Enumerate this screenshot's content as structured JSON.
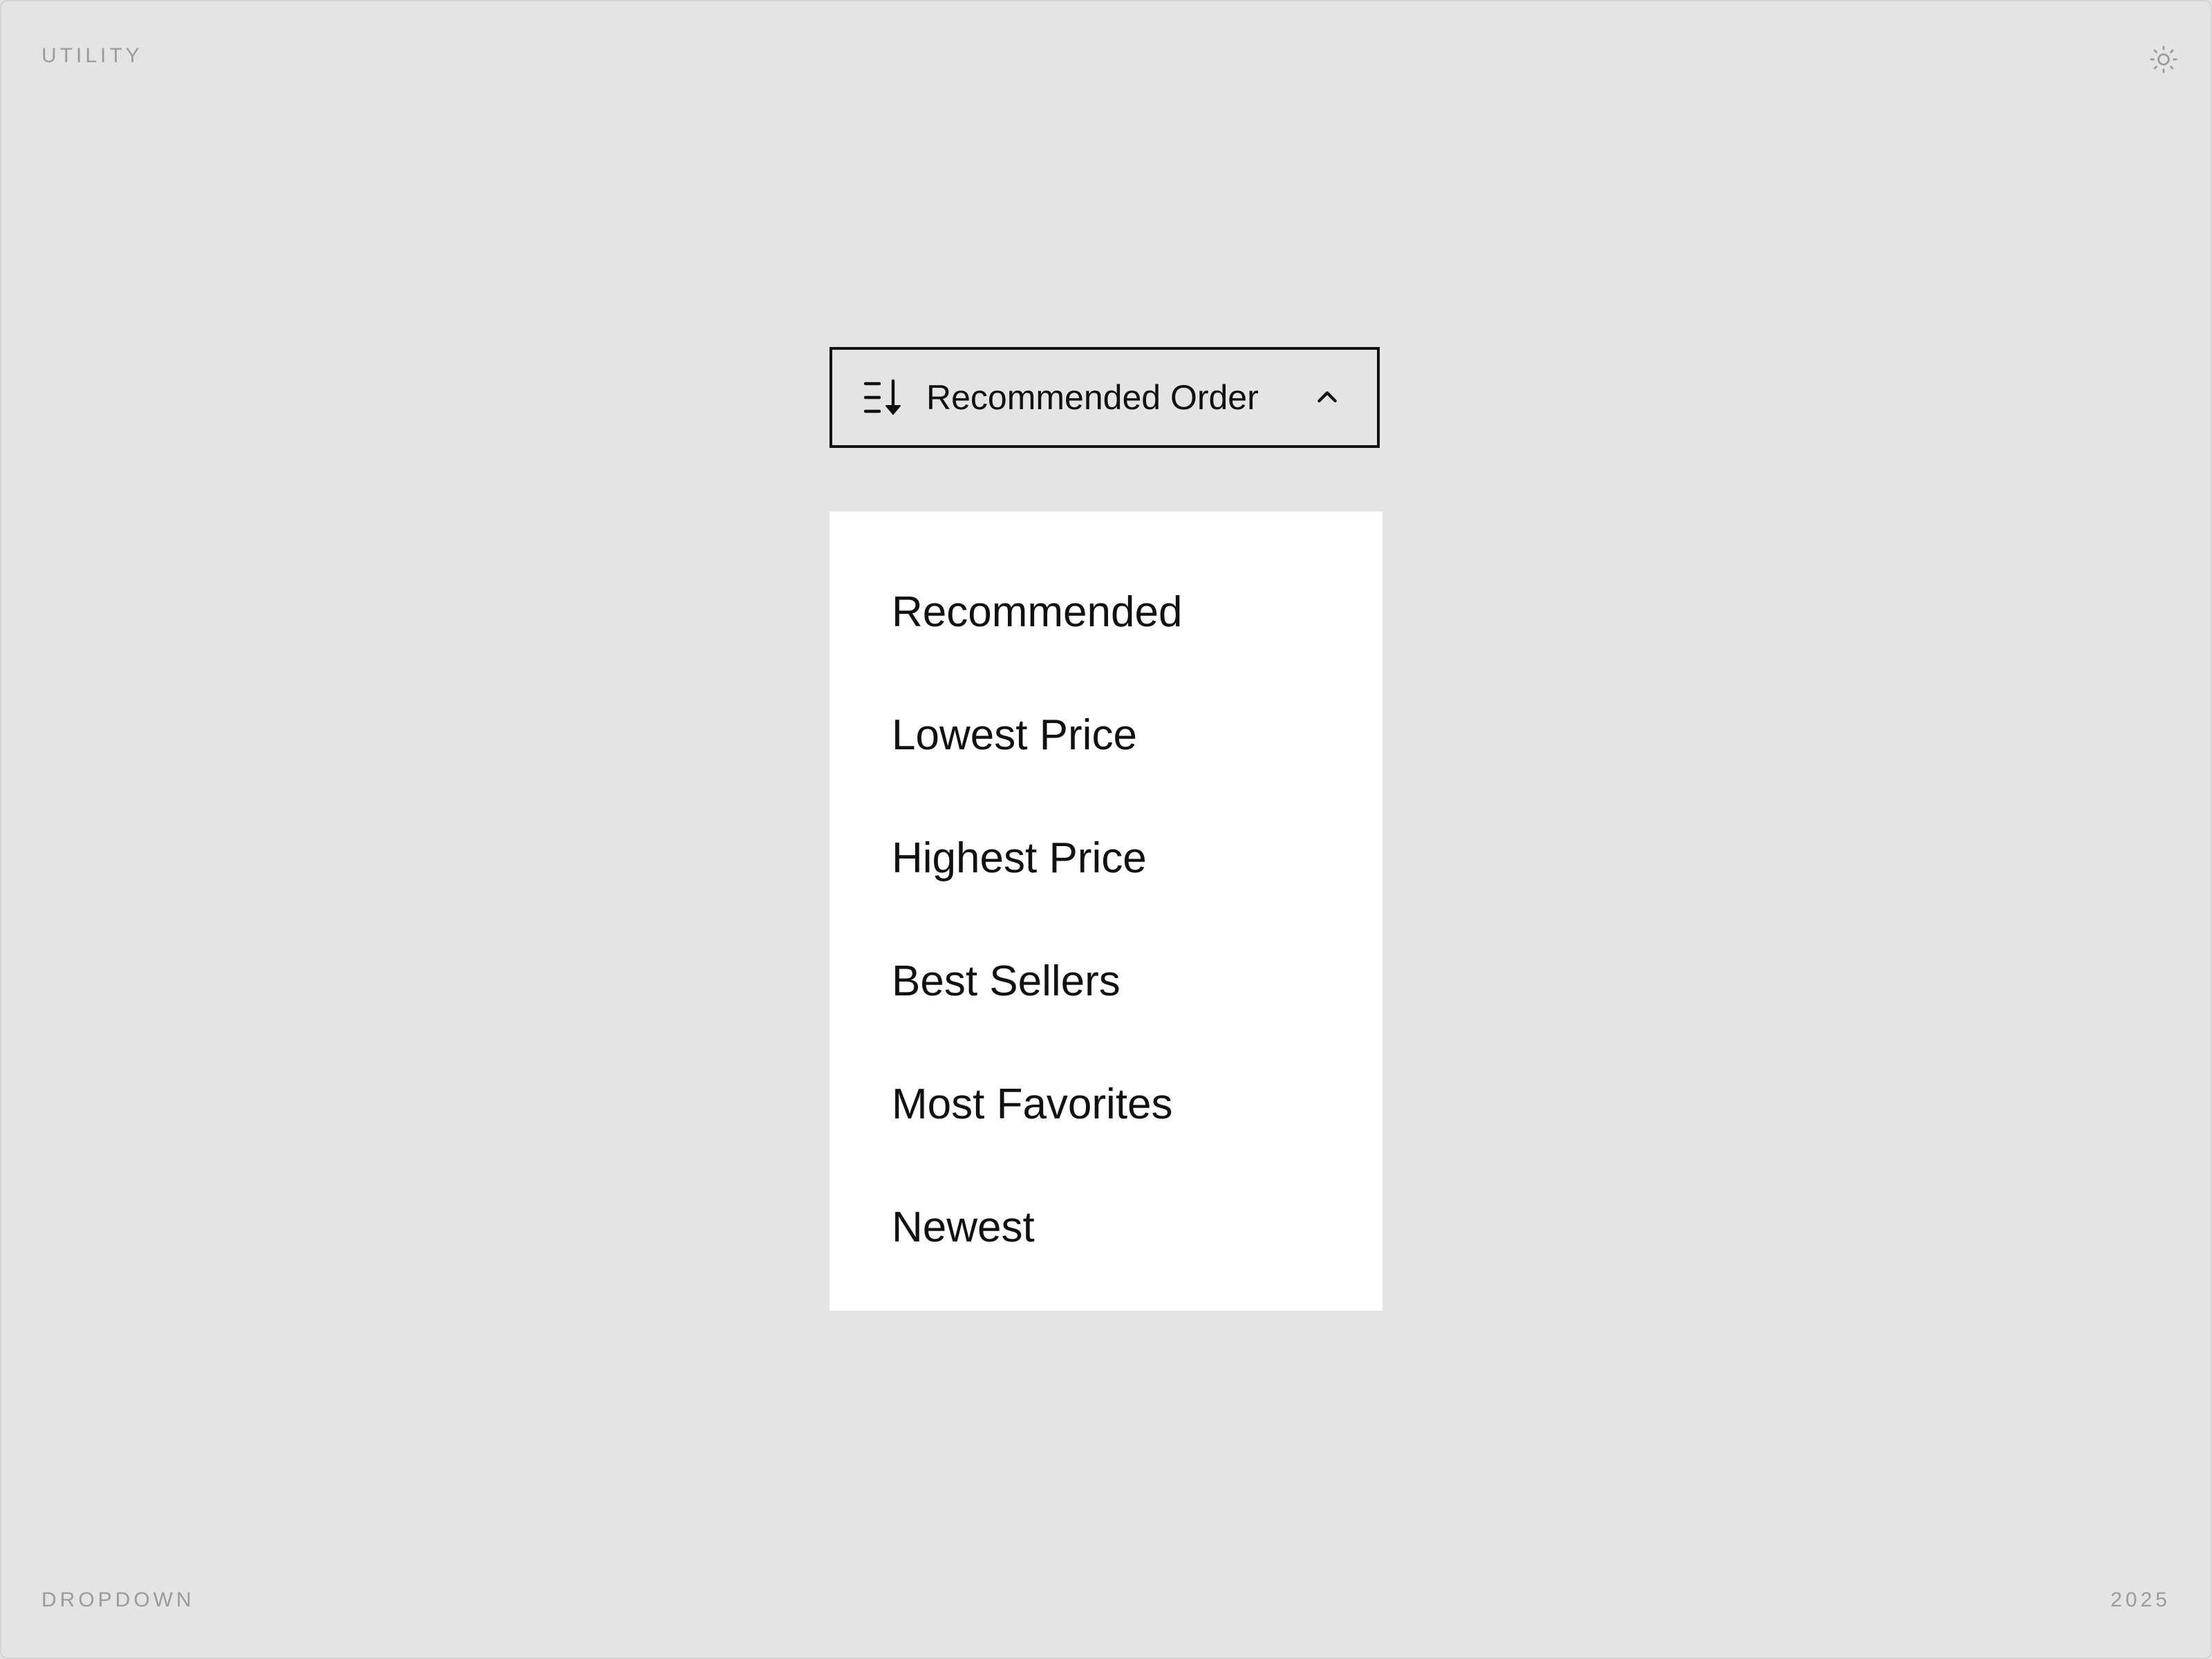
{
  "corner_labels": {
    "top_left": "UTILITY",
    "bottom_left": "DROPDOWN",
    "bottom_right": "2025"
  },
  "theme_toggle": {
    "icon": "sun-icon"
  },
  "dropdown": {
    "selected_label": "Recommended Order",
    "leading_icon": "sort-descending-icon",
    "trailing_icon": "chevron-up-icon",
    "expanded": true,
    "options": [
      {
        "label": "Recommended"
      },
      {
        "label": "Lowest Price"
      },
      {
        "label": "Highest Price"
      },
      {
        "label": "Best Sellers"
      },
      {
        "label": "Most Favorites"
      },
      {
        "label": "Newest"
      }
    ]
  },
  "colors": {
    "background": "#e4e4e4",
    "menu_background": "#ffffff",
    "text": "#111111",
    "muted_text": "#9b9b9b",
    "border": "#111111"
  }
}
